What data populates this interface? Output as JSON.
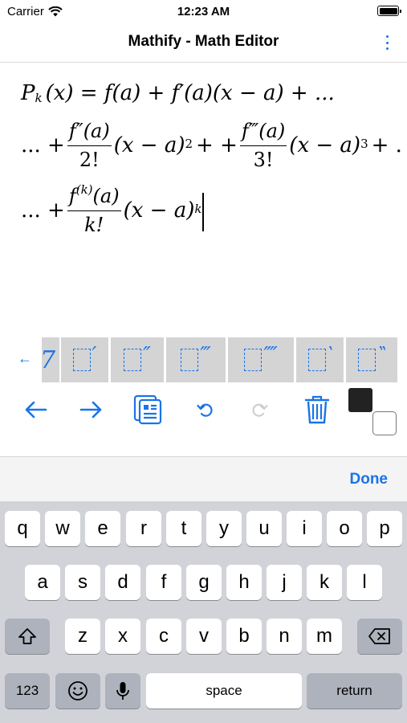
{
  "status": {
    "carrier": "Carrier",
    "time": "12:23 AM"
  },
  "nav": {
    "title": "Mathify - Math Editor",
    "more_icon": "vertical-ellipsis-icon"
  },
  "formula": {
    "line1": {
      "lhs": "P",
      "sub": "k",
      "arg": "(x) = f(a) + f′(a)(x − a) + ..."
    },
    "line2": {
      "lead": "... +",
      "t1_num": "f″(a)",
      "t1_den": "2!",
      "t1_tail": "(x − a)",
      "t1_pow": "2",
      "mid": "+ +",
      "t2_num": "f‴(a)",
      "t2_den": "3!",
      "t2_tail": "(x − a)",
      "t2_pow": "3",
      "end": "+ ."
    },
    "line3": {
      "lead": "... +",
      "num_f": "f",
      "num_pow": "(k)",
      "num_arg": "(a)",
      "den": "k!",
      "tail": "(x − a)",
      "pow": "k"
    }
  },
  "strip": {
    "left_arrow": "←",
    "right_glyph": "7",
    "templates": [
      "′",
      "″",
      "‴",
      "⁗",
      "‵",
      "‶"
    ]
  },
  "toolbar": {
    "back_icon": "left-arrow-icon",
    "forward_icon": "right-arrow-icon",
    "paste_icon": "clipboard-icon",
    "undo_icon": "undo-icon",
    "redo_icon": "redo-icon",
    "delete_icon": "trash-icon",
    "foreground_color": "#222222",
    "background_color": "#ffffff"
  },
  "done_label": "Done",
  "keyboard": {
    "row1": [
      "q",
      "w",
      "e",
      "r",
      "t",
      "y",
      "u",
      "i",
      "o",
      "p"
    ],
    "row2": [
      "a",
      "s",
      "d",
      "f",
      "g",
      "h",
      "j",
      "k",
      "l"
    ],
    "row3": [
      "z",
      "x",
      "c",
      "v",
      "b",
      "n",
      "m"
    ],
    "numbers_label": "123",
    "space_label": "space",
    "return_label": "return"
  },
  "accent_color": "#1a73e8"
}
